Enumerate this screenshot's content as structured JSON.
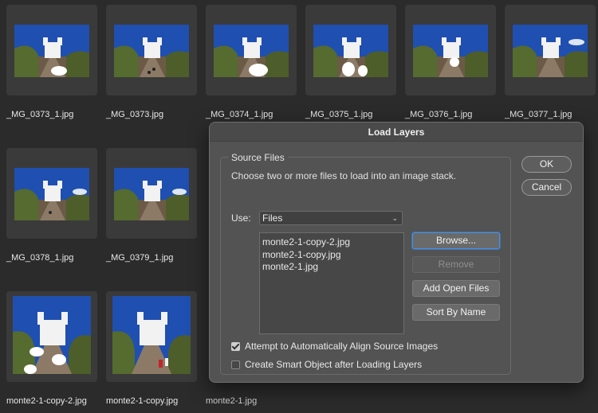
{
  "thumbnails": [
    {
      "name": "_MG_0373_1.jpg"
    },
    {
      "name": "_MG_0373.jpg"
    },
    {
      "name": "_MG_0374_1.jpg"
    },
    {
      "name": "_MG_0375_1.jpg"
    },
    {
      "name": "_MG_0376_1.jpg"
    },
    {
      "name": "_MG_0377_1.jpg"
    },
    {
      "name": "_MG_0378_1.jpg"
    },
    {
      "name": "_MG_0379_1.jpg"
    },
    {
      "name": "monte2-1-copy-2.jpg"
    },
    {
      "name": "monte2-1-copy.jpg"
    },
    {
      "name": "monte2-1.jpg"
    }
  ],
  "dialog": {
    "title": "Load Layers",
    "group_title": "Source Files",
    "instruction": "Choose two or more files to load into an image stack.",
    "use_label": "Use:",
    "use_value": "Files",
    "files": [
      "monte2-1-copy-2.jpg",
      "monte2-1-copy.jpg",
      "monte2-1.jpg"
    ],
    "browse_label": "Browse...",
    "remove_label": "Remove",
    "add_open_label": "Add Open Files",
    "sort_label": "Sort By Name",
    "align_label": "Attempt to Automatically Align Source Images",
    "align_checked": true,
    "smart_label": "Create Smart Object after Loading Layers",
    "smart_checked": false,
    "ok_label": "OK",
    "cancel_label": "Cancel"
  },
  "colors": {
    "background": "#2b2b2b",
    "dialog": "#535353",
    "focus": "#4f8fd6",
    "sky": "#1f4fb0"
  }
}
